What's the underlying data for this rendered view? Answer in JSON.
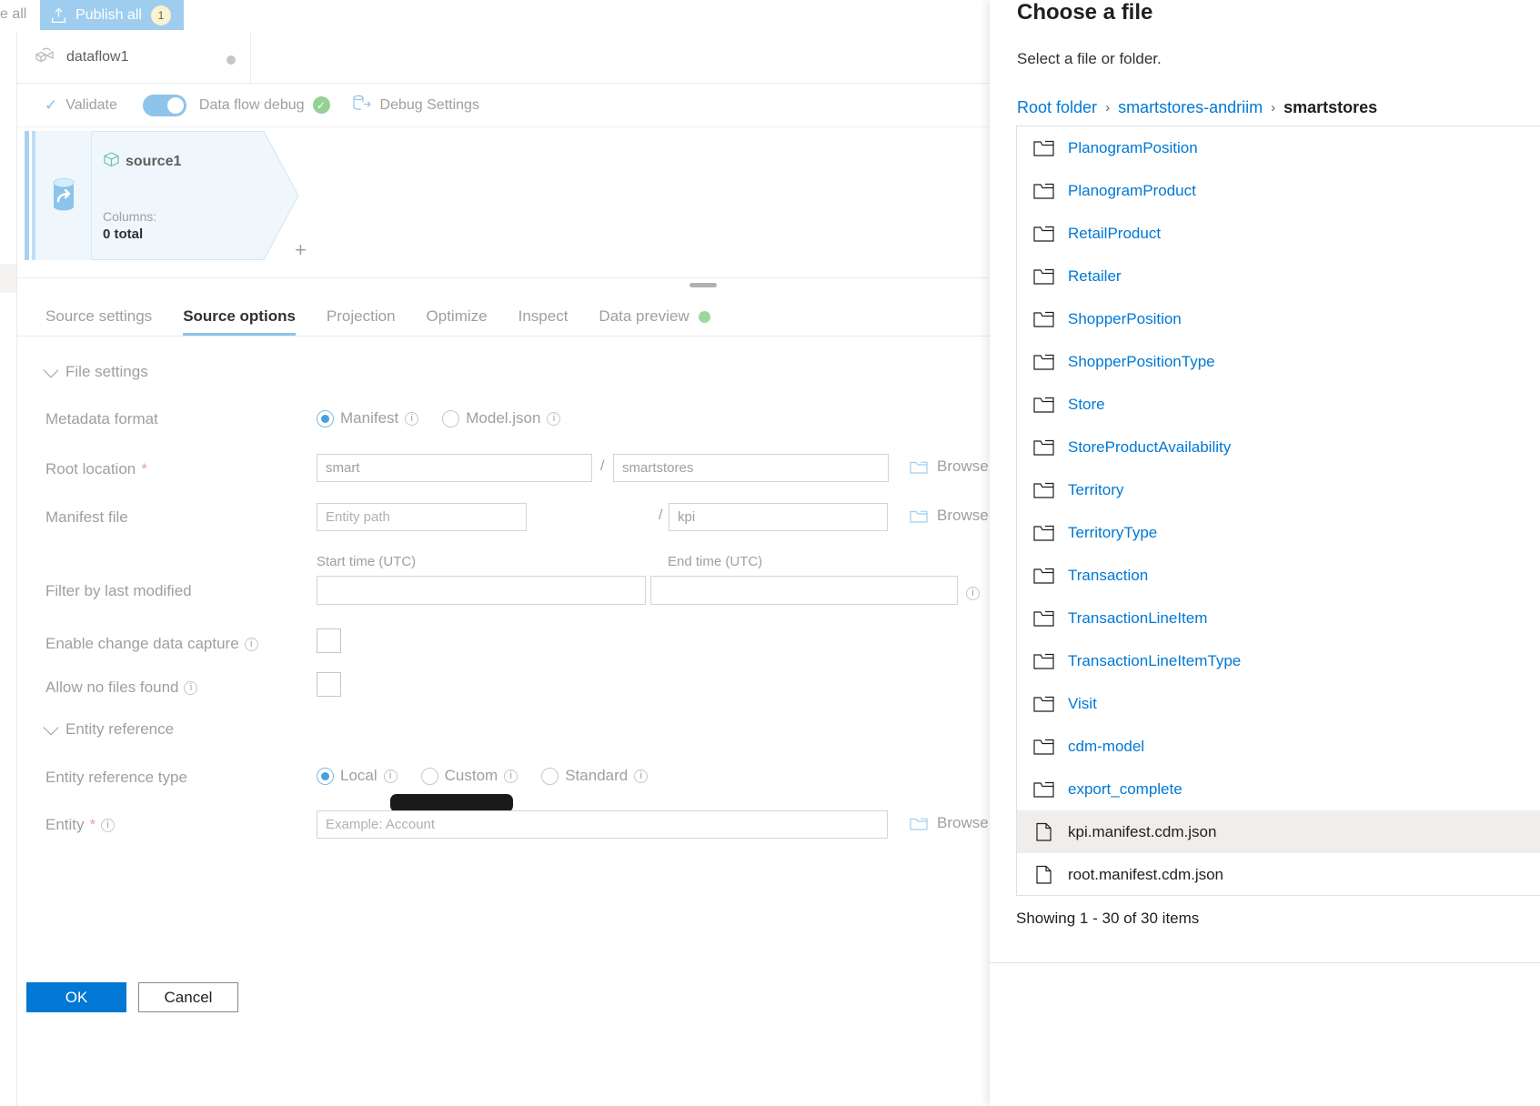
{
  "topbar": {
    "save_all_label": "e all",
    "publish_all_label": "Publish all",
    "publish_badge": "1",
    "publish_icon": "upload-icon"
  },
  "dataflow_tab": {
    "name": "dataflow1",
    "icon": "dataflow-icon",
    "status_dot": "modified-dot"
  },
  "commandbar": {
    "validate_label": "Validate",
    "validate_icon": "check-icon",
    "debug_toggle_label": "Data flow debug",
    "debug_toggle_on": true,
    "debug_status_icon": "green-check-icon",
    "debug_settings_label": "Debug Settings",
    "debug_settings_icon": "debug-settings-icon"
  },
  "canvas": {
    "node": {
      "name": "source1",
      "icon": "source-database-icon",
      "stream_icon": "source-stream-icon",
      "columns_label": "Columns:",
      "columns_value": "0 total"
    },
    "add_icon": "plus-icon"
  },
  "details": {
    "tabs": [
      {
        "label": "Source settings",
        "active": false
      },
      {
        "label": "Source options",
        "active": true
      },
      {
        "label": "Projection",
        "active": false
      },
      {
        "label": "Optimize",
        "active": false
      },
      {
        "label": "Inspect",
        "active": false
      },
      {
        "label": "Data preview",
        "active": false,
        "dot": true
      }
    ]
  },
  "form": {
    "file_settings_section": "File settings",
    "entity_reference_section": "Entity reference",
    "metadata_format": {
      "label": "Metadata format",
      "options": [
        {
          "label": "Manifest",
          "selected": true,
          "info": true
        },
        {
          "label": "Model.json",
          "selected": false,
          "info": true
        }
      ]
    },
    "root_location": {
      "label": "Root location",
      "required": "*",
      "container_value": "smart",
      "container_placeholder": "smart",
      "separator": "/",
      "folder_value": "smartstores",
      "browse_label": "Browse"
    },
    "manifest_file": {
      "label": "Manifest file",
      "entity_path_placeholder": "Entity path",
      "separator": "/",
      "file_value": "kpi",
      "browse_label": "Browse"
    },
    "filter_by_last_modified": {
      "label": "Filter by last modified",
      "start_time_header": "Start time (UTC)",
      "end_time_header": "End time (UTC)",
      "start_time_value": "",
      "end_time_value": "",
      "info": true
    },
    "enable_cdc": {
      "label": "Enable change data capture",
      "checked": false,
      "info": true
    },
    "allow_no_files": {
      "label": "Allow no files found",
      "checked": false,
      "info": true
    },
    "entity_reference_type": {
      "label": "Entity reference type",
      "options": [
        {
          "label": "Local",
          "selected": true,
          "info": true
        },
        {
          "label": "Custom",
          "selected": false,
          "info": true
        },
        {
          "label": "Standard",
          "selected": false,
          "info": true
        }
      ]
    },
    "entity": {
      "label": "Entity",
      "required": "*",
      "info": true,
      "placeholder": "Example: Account",
      "value": "",
      "browse_label": "Browse"
    }
  },
  "dialog": {
    "title": "Choose a file",
    "subtitle": "Select a file or folder.",
    "breadcrumb": [
      {
        "label": "Root folder",
        "current": false
      },
      {
        "label": "smartstores-andriim",
        "current": false
      },
      {
        "label": "smartstores",
        "current": true
      }
    ],
    "breadcrumb_separator": "›",
    "items": [
      {
        "name": "PlanogramPosition",
        "type": "folder",
        "selected": false
      },
      {
        "name": "PlanogramProduct",
        "type": "folder",
        "selected": false
      },
      {
        "name": "RetailProduct",
        "type": "folder",
        "selected": false
      },
      {
        "name": "Retailer",
        "type": "folder",
        "selected": false
      },
      {
        "name": "ShopperPosition",
        "type": "folder",
        "selected": false
      },
      {
        "name": "ShopperPositionType",
        "type": "folder",
        "selected": false
      },
      {
        "name": "Store",
        "type": "folder",
        "selected": false
      },
      {
        "name": "StoreProductAvailability",
        "type": "folder",
        "selected": false
      },
      {
        "name": "Territory",
        "type": "folder",
        "selected": false
      },
      {
        "name": "TerritoryType",
        "type": "folder",
        "selected": false
      },
      {
        "name": "Transaction",
        "type": "folder",
        "selected": false
      },
      {
        "name": "TransactionLineItem",
        "type": "folder",
        "selected": false
      },
      {
        "name": "TransactionLineItemType",
        "type": "folder",
        "selected": false
      },
      {
        "name": "Visit",
        "type": "folder",
        "selected": false
      },
      {
        "name": "cdm-model",
        "type": "folder",
        "selected": false
      },
      {
        "name": "export_complete",
        "type": "folder",
        "selected": false
      },
      {
        "name": "kpi.manifest.cdm.json",
        "type": "file",
        "selected": true
      },
      {
        "name": "root.manifest.cdm.json",
        "type": "file",
        "selected": false
      }
    ],
    "showing_text": "Showing 1 - 30 of 30 items",
    "ok_label": "OK",
    "cancel_label": "Cancel"
  },
  "colors": {
    "accent_blue": "#0078d4",
    "link_blue": "#0078d4",
    "publish_bg": "#9fcdf0",
    "badge_bg": "#faf3cd",
    "tab_underline": "#8cc4ea",
    "green_status": "#9ed79e",
    "selected_row": "#efeeed"
  }
}
